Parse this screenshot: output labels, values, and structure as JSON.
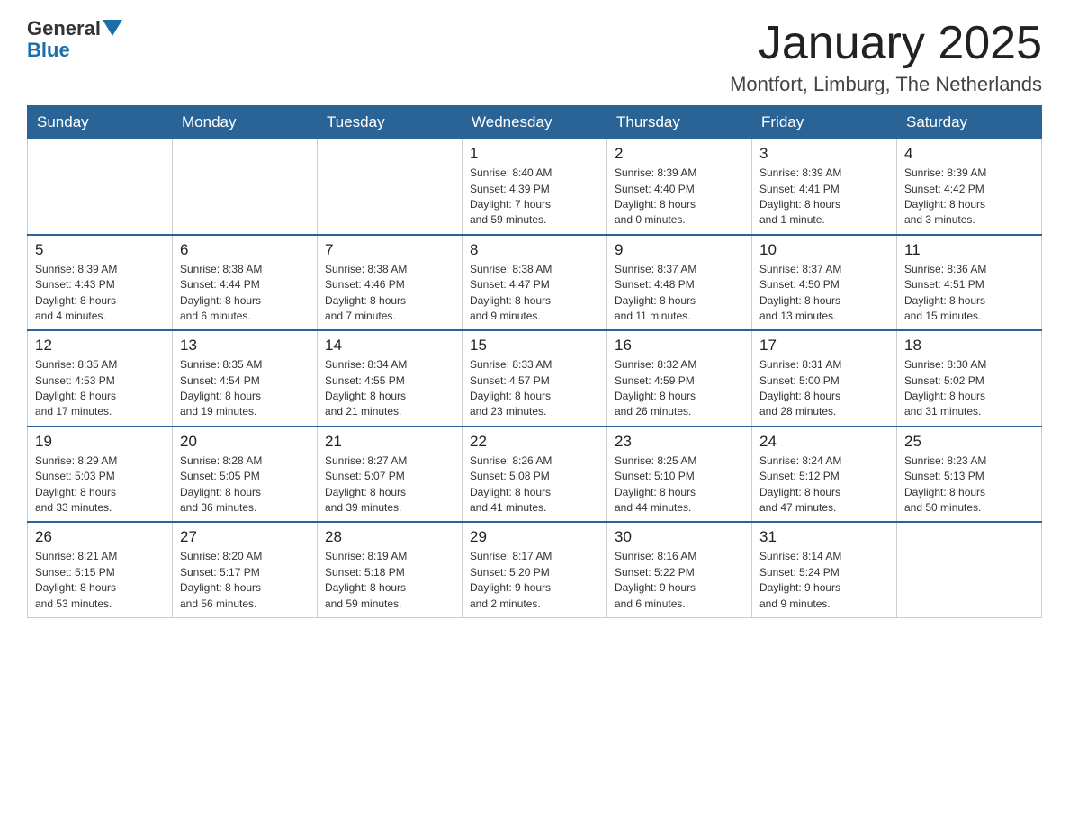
{
  "header": {
    "logo_line1": "General",
    "logo_line2": "Blue",
    "title": "January 2025",
    "subtitle": "Montfort, Limburg, The Netherlands"
  },
  "weekdays": [
    "Sunday",
    "Monday",
    "Tuesday",
    "Wednesday",
    "Thursday",
    "Friday",
    "Saturday"
  ],
  "weeks": [
    [
      {
        "day": "",
        "info": ""
      },
      {
        "day": "",
        "info": ""
      },
      {
        "day": "",
        "info": ""
      },
      {
        "day": "1",
        "info": "Sunrise: 8:40 AM\nSunset: 4:39 PM\nDaylight: 7 hours\nand 59 minutes."
      },
      {
        "day": "2",
        "info": "Sunrise: 8:39 AM\nSunset: 4:40 PM\nDaylight: 8 hours\nand 0 minutes."
      },
      {
        "day": "3",
        "info": "Sunrise: 8:39 AM\nSunset: 4:41 PM\nDaylight: 8 hours\nand 1 minute."
      },
      {
        "day": "4",
        "info": "Sunrise: 8:39 AM\nSunset: 4:42 PM\nDaylight: 8 hours\nand 3 minutes."
      }
    ],
    [
      {
        "day": "5",
        "info": "Sunrise: 8:39 AM\nSunset: 4:43 PM\nDaylight: 8 hours\nand 4 minutes."
      },
      {
        "day": "6",
        "info": "Sunrise: 8:38 AM\nSunset: 4:44 PM\nDaylight: 8 hours\nand 6 minutes."
      },
      {
        "day": "7",
        "info": "Sunrise: 8:38 AM\nSunset: 4:46 PM\nDaylight: 8 hours\nand 7 minutes."
      },
      {
        "day": "8",
        "info": "Sunrise: 8:38 AM\nSunset: 4:47 PM\nDaylight: 8 hours\nand 9 minutes."
      },
      {
        "day": "9",
        "info": "Sunrise: 8:37 AM\nSunset: 4:48 PM\nDaylight: 8 hours\nand 11 minutes."
      },
      {
        "day": "10",
        "info": "Sunrise: 8:37 AM\nSunset: 4:50 PM\nDaylight: 8 hours\nand 13 minutes."
      },
      {
        "day": "11",
        "info": "Sunrise: 8:36 AM\nSunset: 4:51 PM\nDaylight: 8 hours\nand 15 minutes."
      }
    ],
    [
      {
        "day": "12",
        "info": "Sunrise: 8:35 AM\nSunset: 4:53 PM\nDaylight: 8 hours\nand 17 minutes."
      },
      {
        "day": "13",
        "info": "Sunrise: 8:35 AM\nSunset: 4:54 PM\nDaylight: 8 hours\nand 19 minutes."
      },
      {
        "day": "14",
        "info": "Sunrise: 8:34 AM\nSunset: 4:55 PM\nDaylight: 8 hours\nand 21 minutes."
      },
      {
        "day": "15",
        "info": "Sunrise: 8:33 AM\nSunset: 4:57 PM\nDaylight: 8 hours\nand 23 minutes."
      },
      {
        "day": "16",
        "info": "Sunrise: 8:32 AM\nSunset: 4:59 PM\nDaylight: 8 hours\nand 26 minutes."
      },
      {
        "day": "17",
        "info": "Sunrise: 8:31 AM\nSunset: 5:00 PM\nDaylight: 8 hours\nand 28 minutes."
      },
      {
        "day": "18",
        "info": "Sunrise: 8:30 AM\nSunset: 5:02 PM\nDaylight: 8 hours\nand 31 minutes."
      }
    ],
    [
      {
        "day": "19",
        "info": "Sunrise: 8:29 AM\nSunset: 5:03 PM\nDaylight: 8 hours\nand 33 minutes."
      },
      {
        "day": "20",
        "info": "Sunrise: 8:28 AM\nSunset: 5:05 PM\nDaylight: 8 hours\nand 36 minutes."
      },
      {
        "day": "21",
        "info": "Sunrise: 8:27 AM\nSunset: 5:07 PM\nDaylight: 8 hours\nand 39 minutes."
      },
      {
        "day": "22",
        "info": "Sunrise: 8:26 AM\nSunset: 5:08 PM\nDaylight: 8 hours\nand 41 minutes."
      },
      {
        "day": "23",
        "info": "Sunrise: 8:25 AM\nSunset: 5:10 PM\nDaylight: 8 hours\nand 44 minutes."
      },
      {
        "day": "24",
        "info": "Sunrise: 8:24 AM\nSunset: 5:12 PM\nDaylight: 8 hours\nand 47 minutes."
      },
      {
        "day": "25",
        "info": "Sunrise: 8:23 AM\nSunset: 5:13 PM\nDaylight: 8 hours\nand 50 minutes."
      }
    ],
    [
      {
        "day": "26",
        "info": "Sunrise: 8:21 AM\nSunset: 5:15 PM\nDaylight: 8 hours\nand 53 minutes."
      },
      {
        "day": "27",
        "info": "Sunrise: 8:20 AM\nSunset: 5:17 PM\nDaylight: 8 hours\nand 56 minutes."
      },
      {
        "day": "28",
        "info": "Sunrise: 8:19 AM\nSunset: 5:18 PM\nDaylight: 8 hours\nand 59 minutes."
      },
      {
        "day": "29",
        "info": "Sunrise: 8:17 AM\nSunset: 5:20 PM\nDaylight: 9 hours\nand 2 minutes."
      },
      {
        "day": "30",
        "info": "Sunrise: 8:16 AM\nSunset: 5:22 PM\nDaylight: 9 hours\nand 6 minutes."
      },
      {
        "day": "31",
        "info": "Sunrise: 8:14 AM\nSunset: 5:24 PM\nDaylight: 9 hours\nand 9 minutes."
      },
      {
        "day": "",
        "info": ""
      }
    ]
  ]
}
